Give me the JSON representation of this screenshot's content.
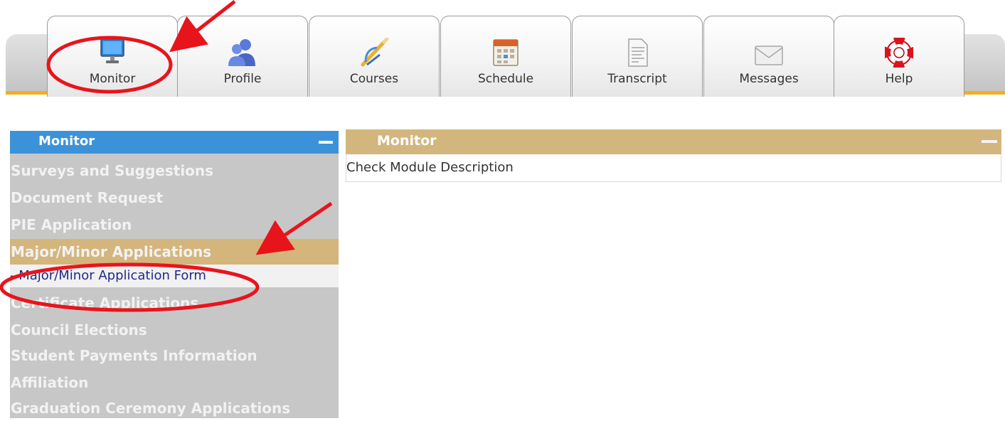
{
  "tabs": [
    {
      "label": "Monitor",
      "icon": "monitor-icon"
    },
    {
      "label": "Profile",
      "icon": "users-icon"
    },
    {
      "label": "Courses",
      "icon": "compass-pencil-icon"
    },
    {
      "label": "Schedule",
      "icon": "calendar-icon"
    },
    {
      "label": "Transcript",
      "icon": "document-icon"
    },
    {
      "label": "Messages",
      "icon": "envelope-icon"
    },
    {
      "label": "Help",
      "icon": "lifebuoy-icon"
    }
  ],
  "sidebar": {
    "title": "Monitor",
    "items": [
      {
        "label": "Surveys and Suggestions"
      },
      {
        "label": "Document Request"
      },
      {
        "label": "PIE Application"
      },
      {
        "label": "Major/Minor Applications"
      },
      {
        "label": "Certificate Applications"
      },
      {
        "label": "Council Elections"
      },
      {
        "label": "Student Payments Information"
      },
      {
        "label": "Affiliation"
      },
      {
        "label": "Graduation Ceremony Applications"
      }
    ],
    "sub_item": "- Major/Minor Application Form"
  },
  "main": {
    "title": "Monitor",
    "description": "Check Module Description"
  },
  "colors": {
    "sidebar_header": "#3c92d8",
    "selected_item": "#d4b57c",
    "main_header": "#d3b67e",
    "annotation": "#e8141c",
    "accent_line": "#f6ad1c"
  }
}
